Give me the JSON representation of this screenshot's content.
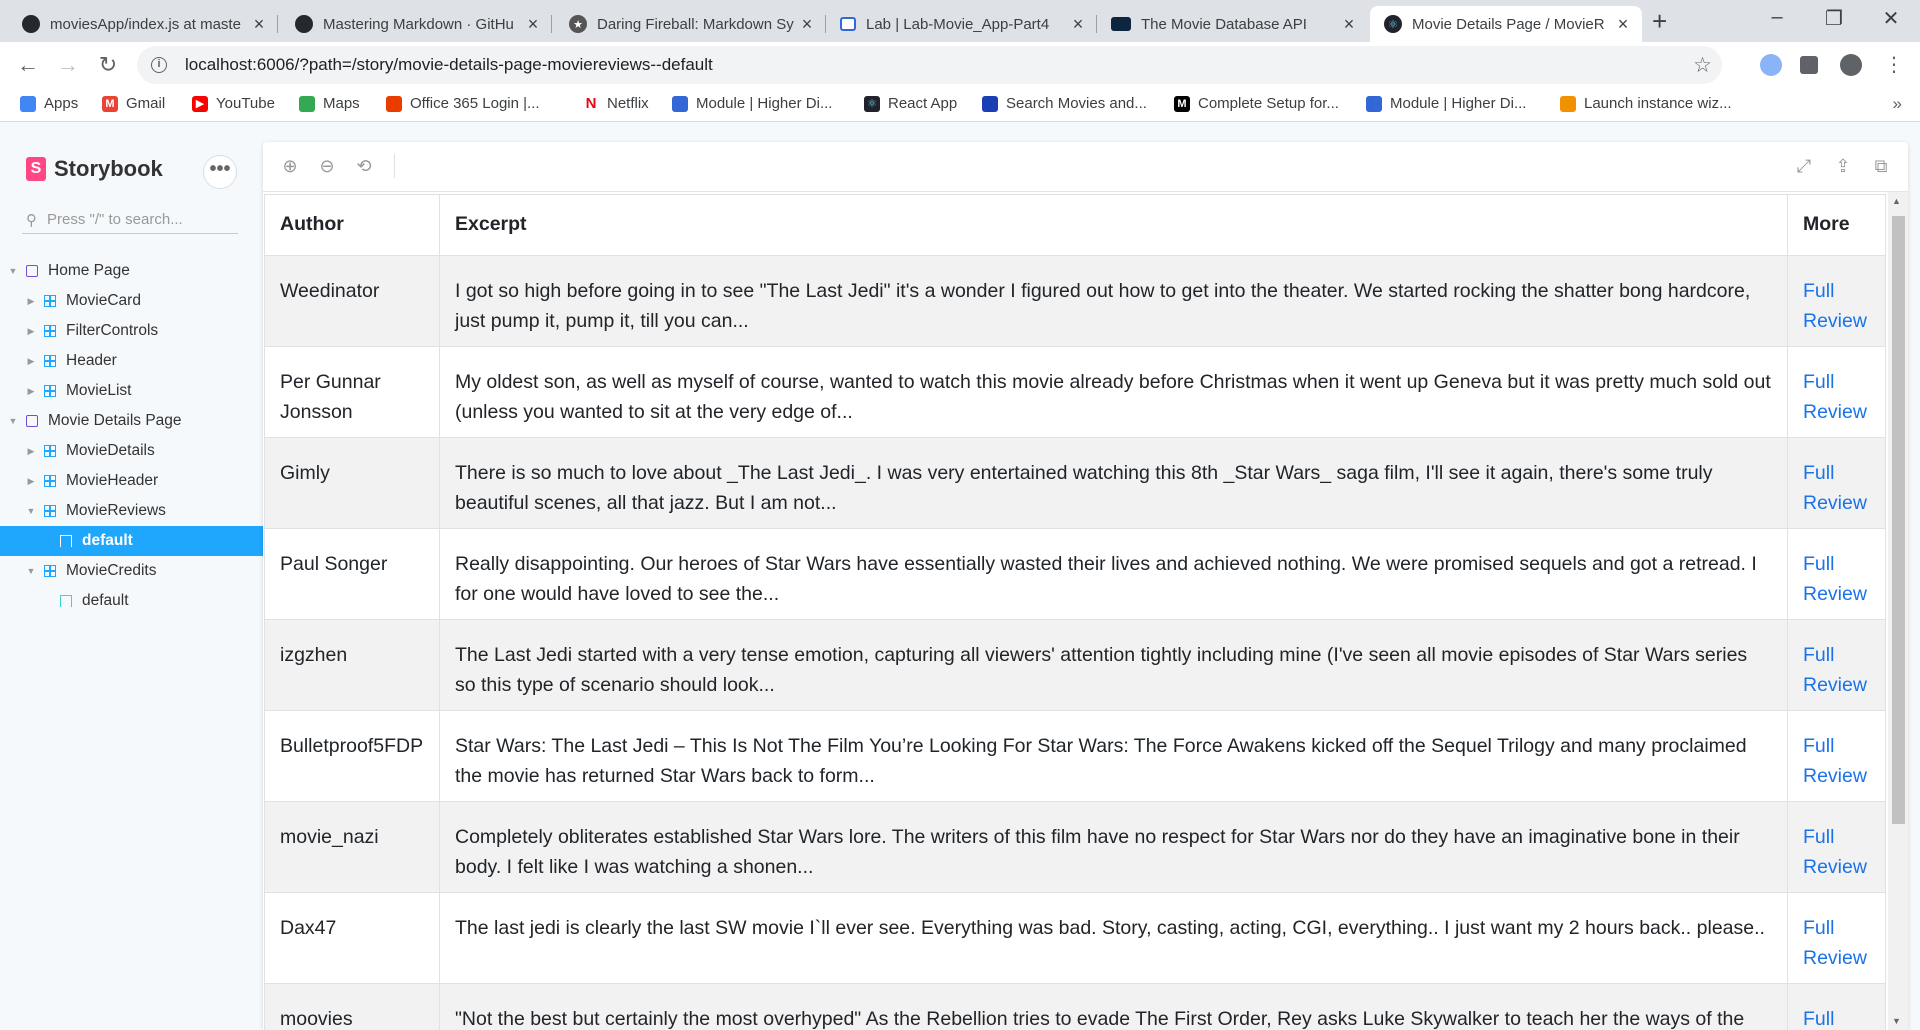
{
  "browser": {
    "tabs": [
      {
        "title": "moviesApp/index.js at maste",
        "icon": "github-icon"
      },
      {
        "title": "Mastering Markdown · GitHu",
        "icon": "github-icon"
      },
      {
        "title": "Daring Fireball: Markdown Sy",
        "icon": "star-icon"
      },
      {
        "title": "Lab | Lab-Movie_App-Part4",
        "icon": "lab-icon"
      },
      {
        "title": "The Movie Database API",
        "icon": "tmdb-icon"
      },
      {
        "title": "Movie Details Page / MovieR",
        "icon": "storybook-icon",
        "active": true
      }
    ],
    "new_tab": "+",
    "url": "localhost:6006/?path=/story/movie-details-page-moviereviews--default",
    "bookmarks": [
      {
        "label": "Apps",
        "color": "#4285f4"
      },
      {
        "label": "Gmail",
        "color": "#ea4335"
      },
      {
        "label": "YouTube",
        "color": "#ff0000"
      },
      {
        "label": "Maps",
        "color": "#34a853"
      },
      {
        "label": "Office 365 Login |...",
        "color": "#eb3c00"
      },
      {
        "label": "Netflix",
        "color": "#e50914"
      },
      {
        "label": "Module | Higher Di...",
        "color": "#3367d6"
      },
      {
        "label": "React App",
        "color": "#20232a"
      },
      {
        "label": "Search Movies and...",
        "color": "#1a3fb5"
      },
      {
        "label": "Complete Setup for...",
        "color": "#000000"
      },
      {
        "label": "Module | Higher Di...",
        "color": "#3367d6"
      },
      {
        "label": "Launch instance wiz...",
        "color": "#f29100"
      }
    ],
    "bookmarks_more": "»"
  },
  "storybook": {
    "brand": "Storybook",
    "menu_label": "•••",
    "search_placeholder": "Press \"/\" to search...",
    "tree": [
      {
        "label": "Home Page",
        "type": "folder",
        "level": 0,
        "expanded": true
      },
      {
        "label": "MovieCard",
        "type": "component",
        "level": 1
      },
      {
        "label": "FilterControls",
        "type": "component",
        "level": 1
      },
      {
        "label": "Header",
        "type": "component",
        "level": 1
      },
      {
        "label": "MovieList",
        "type": "component",
        "level": 1
      },
      {
        "label": "Movie Details Page",
        "type": "folder",
        "level": 0,
        "expanded": true
      },
      {
        "label": "MovieDetails",
        "type": "component",
        "level": 1
      },
      {
        "label": "MovieHeader",
        "type": "component",
        "level": 1
      },
      {
        "label": "MovieReviews",
        "type": "component",
        "level": 1,
        "expanded": true
      },
      {
        "label": "default",
        "type": "story",
        "level": 2,
        "selected": true
      },
      {
        "label": "MovieCredits",
        "type": "component",
        "level": 1,
        "expanded": true
      },
      {
        "label": "default",
        "type": "story",
        "level": 2
      }
    ],
    "accent_color": "#1ea7fd",
    "brand_color": "#ff4785"
  },
  "reviews_table": {
    "headers": [
      "Author",
      "Excerpt",
      "More"
    ],
    "rows": [
      {
        "author": "Weedinator",
        "excerpt": "I got so high before going in to see \"The Last Jedi\" it's a wonder I figured out how to get into the theater. We started rocking the shatter bong hardcore, just pump it, pump it, till you can...",
        "more": "Full Review"
      },
      {
        "author": "Per Gunnar Jonsson",
        "excerpt": "My oldest son, as well as myself of course, wanted to watch this movie already before Christmas when it went up Geneva but it was pretty much sold out (unless you wanted to sit at the very edge of...",
        "more": "Full Review"
      },
      {
        "author": "Gimly",
        "excerpt": "There is so much to love about _The Last Jedi_. I was very entertained watching this 8th _Star Wars_ saga film, I'll see it again, there's some truly beautiful scenes, all that jazz. But I am not...",
        "more": "Full Review"
      },
      {
        "author": "Paul Songer",
        "excerpt": "Really disappointing. Our heroes of Star Wars have essentially wasted their lives and achieved nothing. We were promised sequels and got a retread. I for one would have loved to see the...",
        "more": "Full Review"
      },
      {
        "author": "izgzhen",
        "excerpt": "The Last Jedi started with a very tense emotion, capturing all viewers' attention tightly including mine (I've seen all movie episodes of Star Wars series so this type of scenario should look...",
        "more": "Full Review"
      },
      {
        "author": "Bulletproof5FDP",
        "excerpt": "Star Wars: The Last Jedi – This Is Not The Film You’re Looking For Star Wars: The Force Awakens kicked off the Sequel Trilogy and many proclaimed the movie has returned Star Wars back to form...",
        "more": "Full Review"
      },
      {
        "author": "movie_nazi",
        "excerpt": "Completely obliterates established Star Wars lore. The writers of this film have no respect for Star Wars nor do they have an imaginative bone in their body. I felt like I was watching a shonen...",
        "more": "Full Review"
      },
      {
        "author": "Dax47",
        "excerpt": "The last jedi is clearly the last SW movie I`ll ever see. Everything was bad. Story, casting, acting, CGI, everything.. I just want my 2 hours back.. please..",
        "more": "Full Review"
      },
      {
        "author": "moovies",
        "excerpt": "\"Not the best but certainly the most overhyped\" As the Rebellion tries to evade The First Order, Rey asks Luke Skywalker to teach her the ways of the",
        "more": "Full"
      }
    ],
    "link_color": "#1a73e8"
  }
}
